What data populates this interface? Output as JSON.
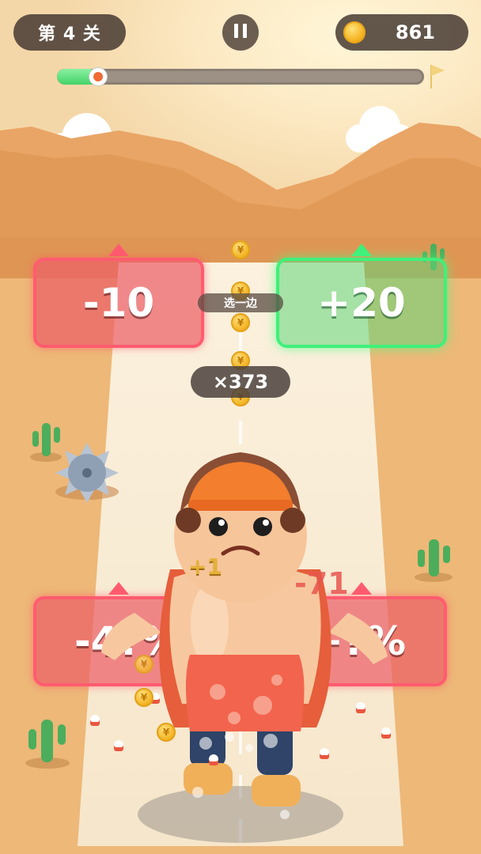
{
  "hud": {
    "level_label": "第 4 关",
    "coin_count": "861",
    "progress": 0.11
  },
  "gates_top": {
    "left_value": "-10",
    "center_hint": "选一边",
    "right_value": "+20"
  },
  "multiplier_label": "×373",
  "gates_bottom": {
    "left_value": "-4?%",
    "right_value": "+?%"
  },
  "floating": {
    "plus_one": "+1",
    "minus_seventy_one": "-71"
  },
  "coin_symbol": "¥",
  "colors": {
    "danger_gate": "#FF5C70",
    "bonus_gate": "#3FF07A",
    "progress_fill": "#44D368",
    "coin": "#F3B424"
  }
}
